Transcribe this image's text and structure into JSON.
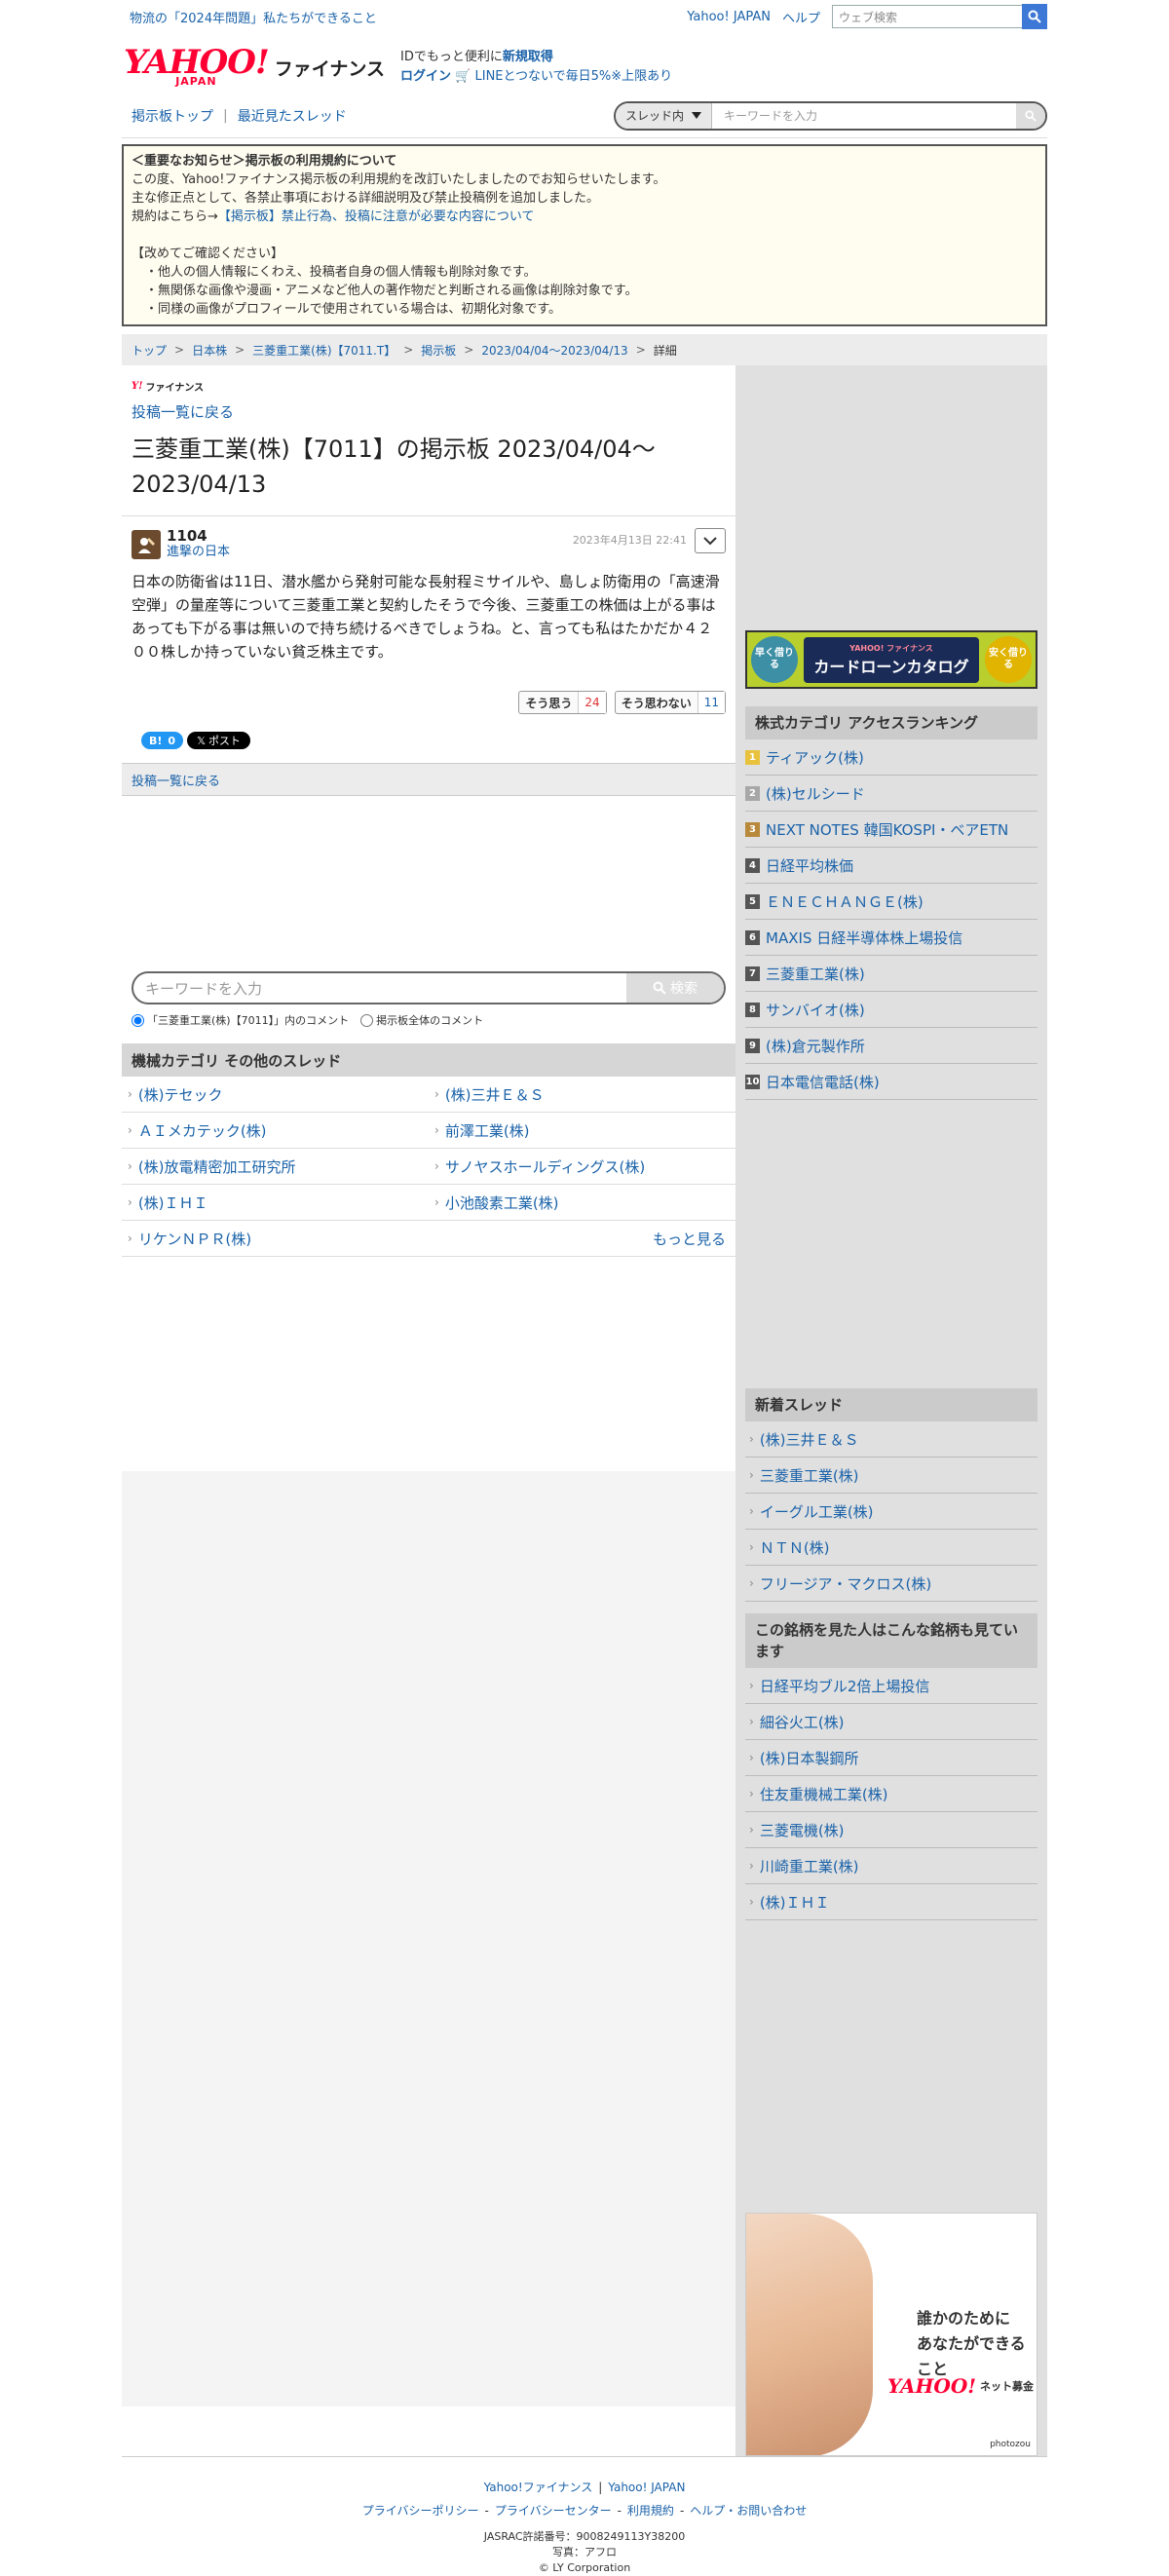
{
  "topbar": {
    "promo": "物流の「2024年問題」私たちができること",
    "yahoo_japan": "Yahoo! JAPAN",
    "help": "ヘルプ",
    "search_placeholder": "ウェブ検索"
  },
  "header": {
    "logo_yahoo": "YAHOO!",
    "logo_japan": "JAPAN",
    "logo_finance": "ファイナンス",
    "id_line_prefix": "IDでもっと便利に",
    "id_line_link": "新規取得",
    "login": "ログイン",
    "line_promo": "LINEとつないで毎日5%※上限あり"
  },
  "nav": {
    "board_top": "掲示板トップ",
    "recent": "最近見たスレッド",
    "scope": "スレッド内",
    "keyword_placeholder": "キーワードを入力"
  },
  "notice": {
    "title": "＜重要なお知らせ＞掲示板の利用規約について",
    "line1": "この度、Yahoo!ファイナンス掲示板の利用規約を改訂いたしましたのでお知らせいたします。",
    "line2": "主な修正点として、各禁止事項における詳細説明及び禁止投稿例を追加しました。",
    "line3_prefix": "規約はこちら→",
    "line3_link": "【掲示板】禁止行為、投稿に注意が必要な内容について",
    "confirm": "【改めてご確認ください】",
    "bullets": [
      "・他人の個人情報にくわえ、投稿者自身の個人情報も削除対象です。",
      "・無関係な画像や漫画・アニメなど他人の著作物だと判断される画像は削除対象です。",
      "・同様の画像がプロフィールで使用されている場合は、初期化対象です。"
    ]
  },
  "breadcrumb": [
    "トップ",
    "日本株",
    "三菱重工業(株)【7011.T】",
    "掲示板",
    "2023/04/04〜2023/04/13",
    "詳細"
  ],
  "main": {
    "mini_logo_y": "Y!",
    "mini_logo_text": "ファイナンス",
    "back": "投稿一覧に戻る",
    "title": "三菱重工業(株)【7011】の掲示板 2023/04/04〜2023/04/13",
    "post": {
      "user_id": "1104",
      "user_name": "進撃の日本",
      "date": "2023年4月13日 22:41",
      "body": "日本の防衛省は11日、潜水艦から発射可能な長射程ミサイルや、島しょ防衛用の「高速滑空弾」の量産等について三菱重工業と契約したそうで今後、三菱重工の株価は上がる事はあっても下がる事は無いので持ち続けるべきでしょうね。と、言っても私はたかだか４２００株しか持っていない貧乏株主です。",
      "agree_label": "そう思う",
      "agree_count": "24",
      "disagree_label": "そう思わない",
      "disagree_count": "11"
    },
    "share": {
      "hatena": "B!",
      "hatena_count": "0",
      "x_label": "ポスト"
    },
    "back2": "投稿一覧に戻る",
    "search": {
      "placeholder": "キーワードを入力",
      "button": "検索",
      "scope_thread": "「三菱重工業(株)【7011】」内のコメント",
      "scope_all": "掲示板全体のコメント"
    },
    "others_title": "機械カテゴリ その他のスレッド",
    "others": [
      "(株)テセック",
      "(株)三井Ｅ＆Ｓ",
      "ＡＩメカテック(株)",
      "前澤工業(株)",
      "(株)放電精密加工研究所",
      "サノヤスホールディングス(株)",
      "(株)ＩＨＩ",
      "小池酸素工業(株)",
      "リケンＮＰＲ(株)"
    ],
    "more": "もっと見る"
  },
  "side": {
    "banner": {
      "left": "早く借りる",
      "mid_brand": "YAHOO! ファイナンス",
      "mid_title": "カードローンカタログ",
      "right": "安く借りる"
    },
    "ranking_title": "株式カテゴリ アクセスランキング",
    "ranking": [
      {
        "num": "1",
        "name": "ティアック(株)"
      },
      {
        "num": "2",
        "name": "(株)セルシード"
      },
      {
        "num": "3",
        "name": "NEXT NOTES 韓国KOSPI・ベアETN"
      },
      {
        "num": "4",
        "name": "日経平均株価"
      },
      {
        "num": "5",
        "name": "ＥＮＥＣＨＡＮＧＥ(株)"
      },
      {
        "num": "6",
        "name": "MAXIS 日経半導体株上場投信"
      },
      {
        "num": "7",
        "name": "三菱重工業(株)"
      },
      {
        "num": "8",
        "name": "サンバイオ(株)"
      },
      {
        "num": "9",
        "name": "(株)倉元製作所"
      },
      {
        "num": "10",
        "name": "日本電信電話(株)"
      }
    ],
    "new_title": "新着スレッド",
    "new_threads": [
      "(株)三井Ｅ＆Ｓ",
      "三菱重工業(株)",
      "イーグル工業(株)",
      "ＮＴＮ(株)",
      "フリージア・マクロス(株)"
    ],
    "also_title": "この銘柄を見た人はこんな銘柄も見ています",
    "also": [
      "日経平均ブル2倍上場投信",
      "細谷火工(株)",
      "(株)日本製鋼所",
      "住友重機械工業(株)",
      "三菱電機(株)",
      "川崎重工業(株)",
      "(株)ＩＨＩ"
    ],
    "photo_ad": {
      "line1": "誰かのために",
      "line2": "あなたができること",
      "brand_y": "YAHOO!",
      "brand_text": "ネット募金",
      "credit": "photozou"
    }
  },
  "footer": {
    "link1": "Yahoo!ファイナンス",
    "link2": "Yahoo! JAPAN",
    "privacy_policy": "プライバシーポリシー",
    "privacy_center": "プライバシーセンター",
    "terms": "利用規約",
    "help": "ヘルプ・お問い合わせ",
    "jasrac": "JASRAC許諾番号：9008249113Y38200",
    "photo": "写真：アフロ",
    "copyright": "© LY Corporation"
  }
}
